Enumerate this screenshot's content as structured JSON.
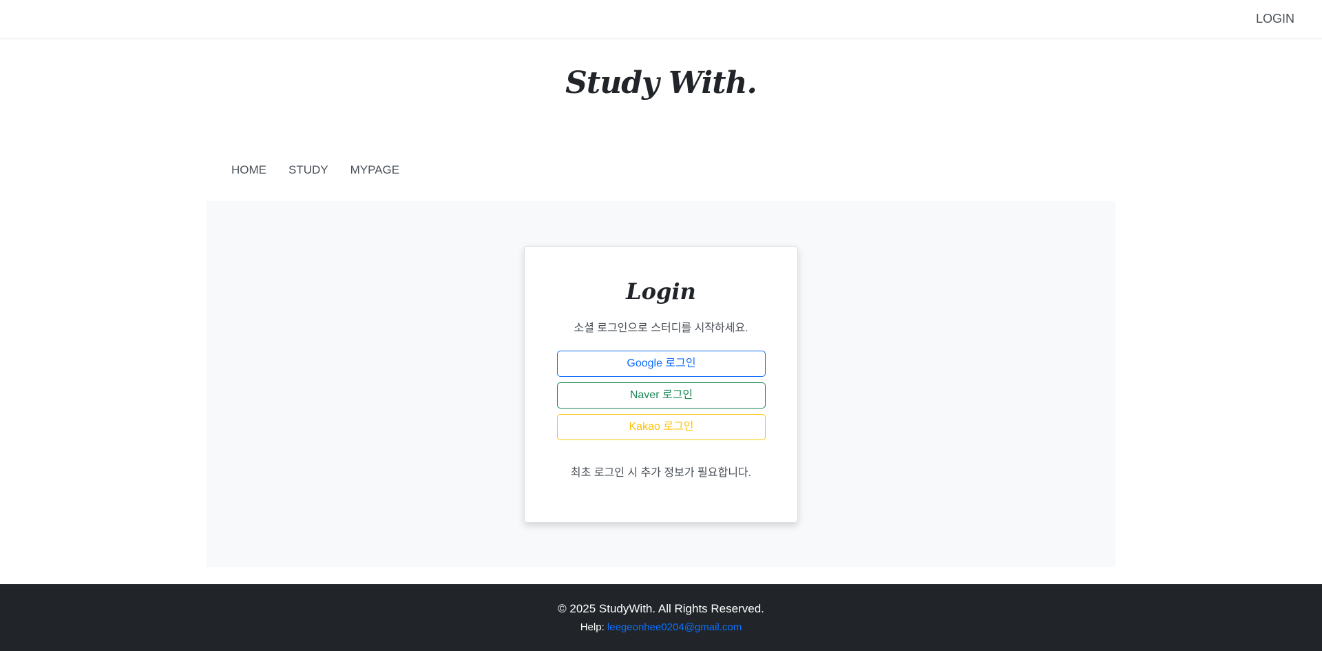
{
  "header": {
    "login_link": "LOGIN"
  },
  "brand": {
    "title": "Study With."
  },
  "nav": {
    "items": [
      {
        "label": "HOME"
      },
      {
        "label": "STUDY"
      },
      {
        "label": "MYPAGE"
      }
    ]
  },
  "login_card": {
    "title": "Login",
    "subtitle": "소셜 로그인으로 스터디를 시작하세요.",
    "buttons": {
      "google": "Google 로그인",
      "naver": "Naver 로그인",
      "kakao": "Kakao 로그인"
    },
    "note": "최초 로그인 시 추가 정보가 필요합니다."
  },
  "footer": {
    "copyright": "© 2025 StudyWith. All Rights Reserved.",
    "help_label": "Help: ",
    "help_email": "leegeonhee0204@gmail.com"
  },
  "colors": {
    "google": "#0d6efd",
    "naver": "#198754",
    "kakao": "#ffc107",
    "footer_bg": "#212529",
    "content_bg": "#f8f9fa"
  }
}
